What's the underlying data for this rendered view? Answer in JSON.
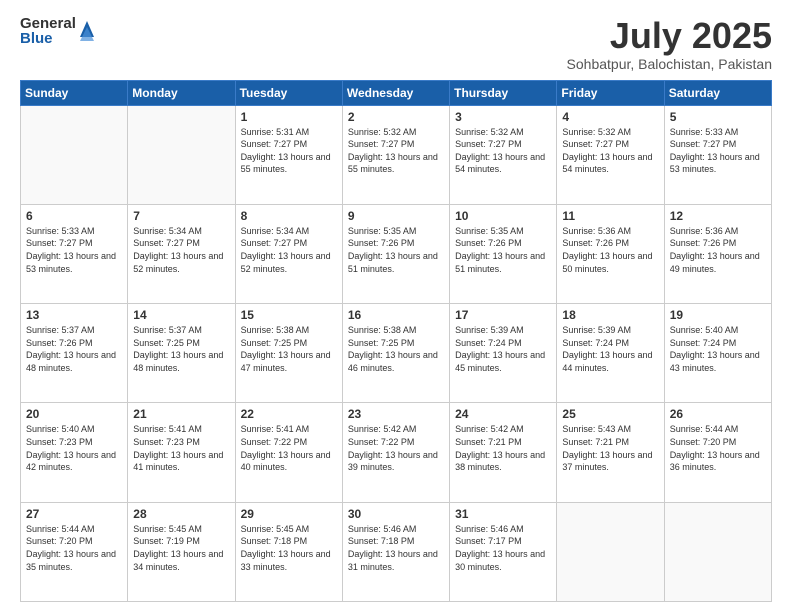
{
  "logo": {
    "general": "General",
    "blue": "Blue"
  },
  "header": {
    "month": "July 2025",
    "location": "Sohbatpur, Balochistan, Pakistan"
  },
  "days_of_week": [
    "Sunday",
    "Monday",
    "Tuesday",
    "Wednesday",
    "Thursday",
    "Friday",
    "Saturday"
  ],
  "weeks": [
    [
      {
        "day": "",
        "info": ""
      },
      {
        "day": "",
        "info": ""
      },
      {
        "day": "1",
        "info": "Sunrise: 5:31 AM\nSunset: 7:27 PM\nDaylight: 13 hours and 55 minutes."
      },
      {
        "day": "2",
        "info": "Sunrise: 5:32 AM\nSunset: 7:27 PM\nDaylight: 13 hours and 55 minutes."
      },
      {
        "day": "3",
        "info": "Sunrise: 5:32 AM\nSunset: 7:27 PM\nDaylight: 13 hours and 54 minutes."
      },
      {
        "day": "4",
        "info": "Sunrise: 5:32 AM\nSunset: 7:27 PM\nDaylight: 13 hours and 54 minutes."
      },
      {
        "day": "5",
        "info": "Sunrise: 5:33 AM\nSunset: 7:27 PM\nDaylight: 13 hours and 53 minutes."
      }
    ],
    [
      {
        "day": "6",
        "info": "Sunrise: 5:33 AM\nSunset: 7:27 PM\nDaylight: 13 hours and 53 minutes."
      },
      {
        "day": "7",
        "info": "Sunrise: 5:34 AM\nSunset: 7:27 PM\nDaylight: 13 hours and 52 minutes."
      },
      {
        "day": "8",
        "info": "Sunrise: 5:34 AM\nSunset: 7:27 PM\nDaylight: 13 hours and 52 minutes."
      },
      {
        "day": "9",
        "info": "Sunrise: 5:35 AM\nSunset: 7:26 PM\nDaylight: 13 hours and 51 minutes."
      },
      {
        "day": "10",
        "info": "Sunrise: 5:35 AM\nSunset: 7:26 PM\nDaylight: 13 hours and 51 minutes."
      },
      {
        "day": "11",
        "info": "Sunrise: 5:36 AM\nSunset: 7:26 PM\nDaylight: 13 hours and 50 minutes."
      },
      {
        "day": "12",
        "info": "Sunrise: 5:36 AM\nSunset: 7:26 PM\nDaylight: 13 hours and 49 minutes."
      }
    ],
    [
      {
        "day": "13",
        "info": "Sunrise: 5:37 AM\nSunset: 7:26 PM\nDaylight: 13 hours and 48 minutes."
      },
      {
        "day": "14",
        "info": "Sunrise: 5:37 AM\nSunset: 7:25 PM\nDaylight: 13 hours and 48 minutes."
      },
      {
        "day": "15",
        "info": "Sunrise: 5:38 AM\nSunset: 7:25 PM\nDaylight: 13 hours and 47 minutes."
      },
      {
        "day": "16",
        "info": "Sunrise: 5:38 AM\nSunset: 7:25 PM\nDaylight: 13 hours and 46 minutes."
      },
      {
        "day": "17",
        "info": "Sunrise: 5:39 AM\nSunset: 7:24 PM\nDaylight: 13 hours and 45 minutes."
      },
      {
        "day": "18",
        "info": "Sunrise: 5:39 AM\nSunset: 7:24 PM\nDaylight: 13 hours and 44 minutes."
      },
      {
        "day": "19",
        "info": "Sunrise: 5:40 AM\nSunset: 7:24 PM\nDaylight: 13 hours and 43 minutes."
      }
    ],
    [
      {
        "day": "20",
        "info": "Sunrise: 5:40 AM\nSunset: 7:23 PM\nDaylight: 13 hours and 42 minutes."
      },
      {
        "day": "21",
        "info": "Sunrise: 5:41 AM\nSunset: 7:23 PM\nDaylight: 13 hours and 41 minutes."
      },
      {
        "day": "22",
        "info": "Sunrise: 5:41 AM\nSunset: 7:22 PM\nDaylight: 13 hours and 40 minutes."
      },
      {
        "day": "23",
        "info": "Sunrise: 5:42 AM\nSunset: 7:22 PM\nDaylight: 13 hours and 39 minutes."
      },
      {
        "day": "24",
        "info": "Sunrise: 5:42 AM\nSunset: 7:21 PM\nDaylight: 13 hours and 38 minutes."
      },
      {
        "day": "25",
        "info": "Sunrise: 5:43 AM\nSunset: 7:21 PM\nDaylight: 13 hours and 37 minutes."
      },
      {
        "day": "26",
        "info": "Sunrise: 5:44 AM\nSunset: 7:20 PM\nDaylight: 13 hours and 36 minutes."
      }
    ],
    [
      {
        "day": "27",
        "info": "Sunrise: 5:44 AM\nSunset: 7:20 PM\nDaylight: 13 hours and 35 minutes."
      },
      {
        "day": "28",
        "info": "Sunrise: 5:45 AM\nSunset: 7:19 PM\nDaylight: 13 hours and 34 minutes."
      },
      {
        "day": "29",
        "info": "Sunrise: 5:45 AM\nSunset: 7:18 PM\nDaylight: 13 hours and 33 minutes."
      },
      {
        "day": "30",
        "info": "Sunrise: 5:46 AM\nSunset: 7:18 PM\nDaylight: 13 hours and 31 minutes."
      },
      {
        "day": "31",
        "info": "Sunrise: 5:46 AM\nSunset: 7:17 PM\nDaylight: 13 hours and 30 minutes."
      },
      {
        "day": "",
        "info": ""
      },
      {
        "day": "",
        "info": ""
      }
    ]
  ]
}
